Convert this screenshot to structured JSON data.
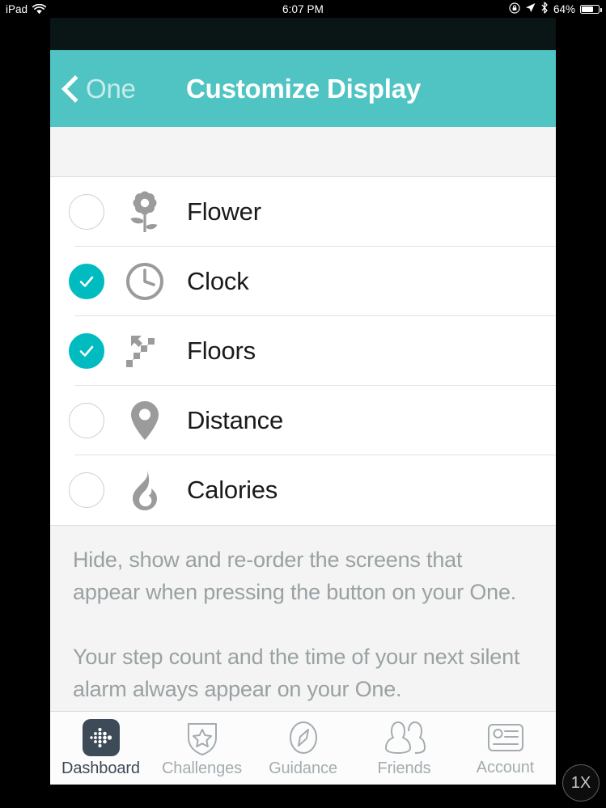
{
  "statusbar": {
    "device": "iPad",
    "wifi_icon": "wifi-icon",
    "time": "6:07 PM",
    "rotation_lock_icon": "rotation-lock-icon",
    "location_icon": "location-arrow-icon",
    "bluetooth_icon": "bluetooth-icon",
    "battery_percent": "64%",
    "battery_icon": "battery-icon"
  },
  "navbar": {
    "back_icon": "chevron-left-icon",
    "back_label": "One",
    "title": "Customize Display",
    "background_color": "#4fc4c3"
  },
  "options": [
    {
      "label": "Flower",
      "icon": "flower-icon",
      "checked": false
    },
    {
      "label": "Clock",
      "icon": "clock-icon",
      "checked": true
    },
    {
      "label": "Floors",
      "icon": "stairs-icon",
      "checked": true
    },
    {
      "label": "Distance",
      "icon": "map-pin-icon",
      "checked": false
    },
    {
      "label": "Calories",
      "icon": "flame-icon",
      "checked": false
    }
  ],
  "checkbox": {
    "checked_color": "#00bcc1",
    "unchecked_border_color": "#cfcfcf",
    "check_icon": "checkmark-icon"
  },
  "note": {
    "paragraph1": "Hide, show and re-order the screens that appear when pressing the button on your One.",
    "paragraph2": "Your step count and the time of your next silent alarm always appear on your One."
  },
  "tabbar": {
    "items": [
      {
        "label": "Dashboard",
        "icon": "fitbit-logo-icon",
        "active": true
      },
      {
        "label": "Challenges",
        "icon": "shield-star-icon",
        "active": false
      },
      {
        "label": "Guidance",
        "icon": "compass-icon",
        "active": false
      },
      {
        "label": "Friends",
        "icon": "friends-icon",
        "active": false
      },
      {
        "label": "Account",
        "icon": "id-card-icon",
        "active": false
      }
    ],
    "active_color": "#3d4a58",
    "inactive_color": "#a4acb0"
  },
  "zoom_badge": {
    "label": "1X"
  }
}
